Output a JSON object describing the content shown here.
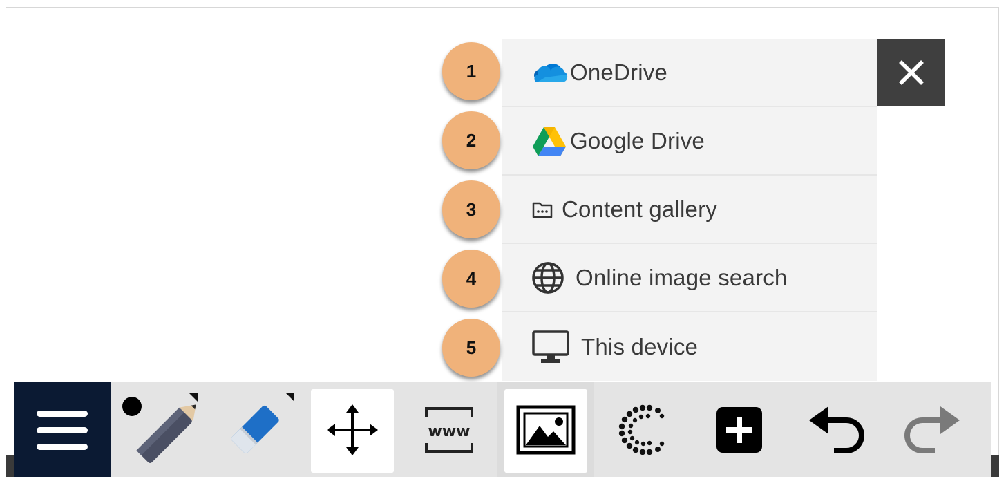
{
  "close_icon": "close-icon",
  "menu": {
    "items": [
      {
        "label": "OneDrive",
        "icon": "onedrive-cloud-icon",
        "badge": "1"
      },
      {
        "label": "Google Drive",
        "icon": "google-drive-icon",
        "badge": "2"
      },
      {
        "label": "Content gallery",
        "icon": "content-gallery-folder-icon",
        "badge": "3"
      },
      {
        "label": "Online image search",
        "icon": "globe-icon",
        "badge": "4"
      },
      {
        "label": "This device",
        "icon": "monitor-icon",
        "badge": "5"
      }
    ]
  },
  "toolbar": {
    "items": [
      "hamburger-menu-icon",
      "pen-icon",
      "eraser-icon",
      "move-icon",
      "web-icon",
      "image-icon",
      "loading-dots-icon",
      "add-icon",
      "undo-icon",
      "redo-icon"
    ]
  },
  "colors": {
    "badge": "#f0b27a",
    "menu_bg": "#f3f3f3",
    "close_bg": "#3f3f3f",
    "toolbar_bg": "#e4e4e4",
    "menu_button_bg": "#0b1a33"
  }
}
